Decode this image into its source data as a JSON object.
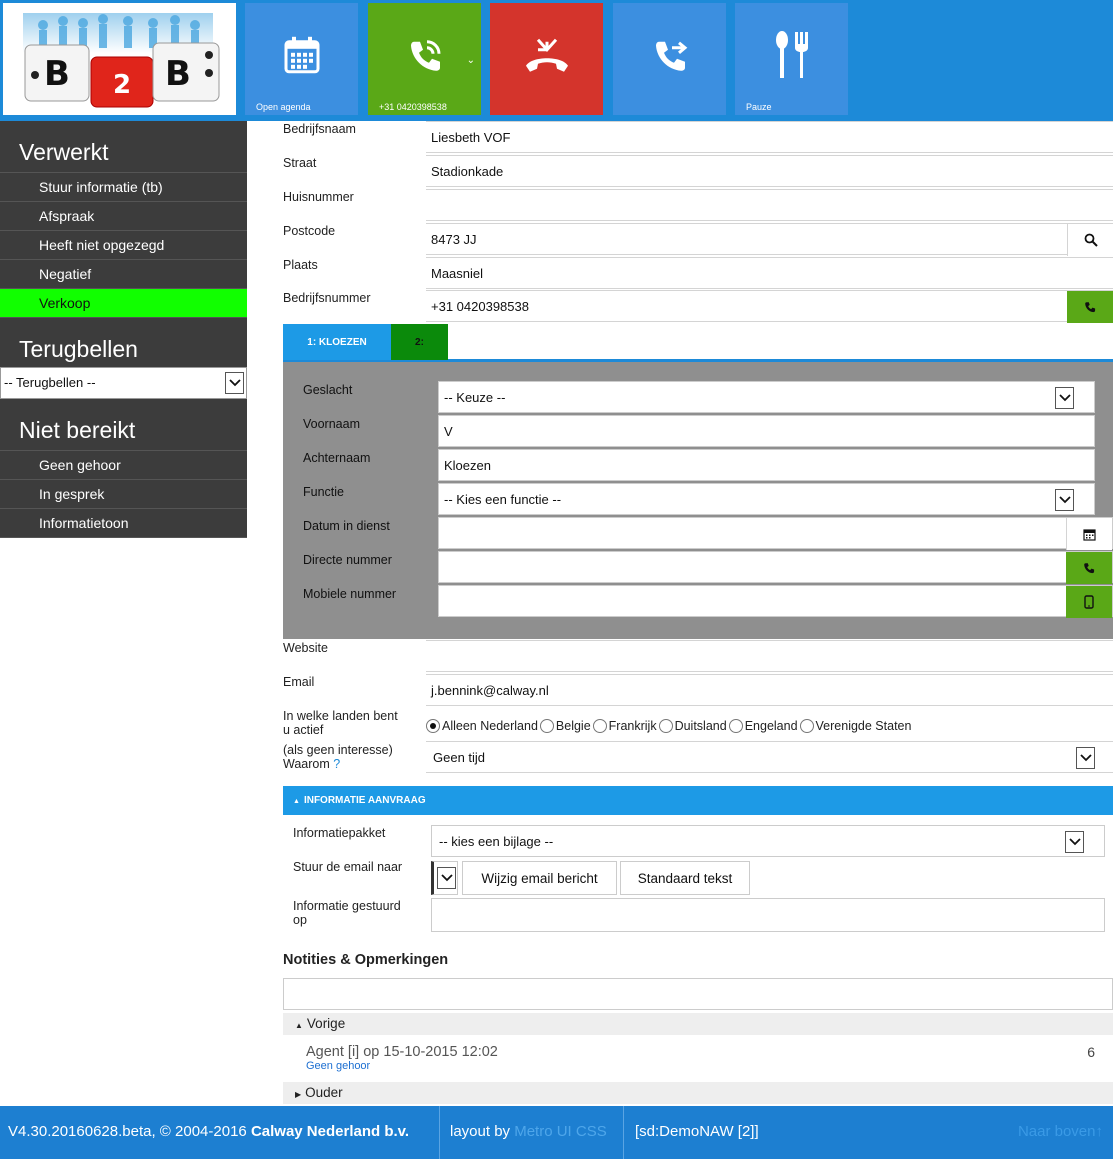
{
  "topbar": {
    "logo_text": [
      "B",
      "2",
      "B"
    ],
    "tiles": [
      {
        "label": "Open agenda",
        "icon": "calendar-icon",
        "color": "#3c8fe0"
      },
      {
        "label": "+31 0420398538",
        "icon": "phone-ringing-icon",
        "color": "#5aa817",
        "dropdown": "⌄"
      },
      {
        "label": "",
        "icon": "hang-up-icon",
        "color": "#d4342c"
      },
      {
        "label": "",
        "icon": "transfer-call-icon",
        "color": "#3c8fe0"
      },
      {
        "label": "Pauze",
        "icon": "fork-spoon-icon",
        "color": "#3c8fe0"
      }
    ]
  },
  "sidebar": {
    "verwerkt": {
      "title": "Verwerkt",
      "items": [
        "Stuur informatie (tb)",
        "Afspraak",
        "Heeft niet opgezegd",
        "Negatief",
        "Verkoop"
      ],
      "active": "Verkoop"
    },
    "terugbellen": {
      "title": "Terugbellen",
      "select_value": "-- Terugbellen --"
    },
    "niet_bereikt": {
      "title": "Niet bereikt",
      "items": [
        "Geen gehoor",
        "In gesprek",
        "Informatietoon"
      ]
    }
  },
  "company": {
    "bedrijfsnaam": {
      "label": "Bedrijfsnaam",
      "value": "Liesbeth VOF"
    },
    "straat": {
      "label": "Straat",
      "value": "Stadionkade"
    },
    "huisnummer": {
      "label": "Huisnummer",
      "value": ""
    },
    "postcode": {
      "label": "Postcode",
      "value": "8473 JJ"
    },
    "plaats": {
      "label": "Plaats",
      "value": "Maasniel"
    },
    "bedrijfsnummer": {
      "label": "Bedrijfsnummer",
      "value": "+31 0420398538"
    }
  },
  "tabs": [
    {
      "label": "1: KLOEZEN",
      "color": "#1d9ae6"
    },
    {
      "label": "2:",
      "color": "#0b8a0b"
    }
  ],
  "contact": {
    "geslacht": {
      "label": "Geslacht",
      "value": "-- Keuze --"
    },
    "voornaam": {
      "label": "Voornaam",
      "value": "V"
    },
    "achternaam": {
      "label": "Achternaam",
      "value": "Kloezen"
    },
    "functie": {
      "label": "Functie",
      "value": "-- Kies een functie --"
    },
    "datum": {
      "label": "Datum in dienst",
      "value": ""
    },
    "directe": {
      "label": "Directe nummer",
      "value": ""
    },
    "mobiel": {
      "label": "Mobiele nummer",
      "value": ""
    }
  },
  "extra": {
    "website": {
      "label": "Website",
      "value": ""
    },
    "email": {
      "label": "Email",
      "value": "j.bennink@calway.nl"
    },
    "landen": {
      "label_line1": "In welke landen bent",
      "label_line2": "u actief",
      "options": [
        "Alleen Nederland",
        "Belgie",
        "Frankrijk",
        "Duitsland",
        "Engeland",
        "Verenigde Staten"
      ],
      "selected": "Alleen Nederland"
    },
    "waarom": {
      "label_line1": "(als geen interesse)",
      "label_line2": "Waarom",
      "help": "?",
      "value": "Geen tijd"
    }
  },
  "info": {
    "section_title": "INFORMATIE AANVRAAG",
    "section_icon": "▲",
    "pakket": {
      "label": "Informatiepakket",
      "value": "-- kies een bijlage --"
    },
    "email_naar": {
      "label": "Stuur de email naar"
    },
    "wijzig_button": "Wijzig email bericht",
    "standaard_button": "Standaard tekst",
    "gestuurd": {
      "label_line1": "Informatie gestuurd",
      "label_line2": "op",
      "value": ""
    }
  },
  "notes": {
    "title": "Notities & Opmerkingen",
    "input_value": "",
    "groups": [
      {
        "label": "Vorige",
        "icon": "▲"
      },
      {
        "label": "Ouder",
        "icon": "▶"
      }
    ],
    "entry": {
      "title": "Agent [i] op 15-10-2015 12:02",
      "sub": "Geen gehoor",
      "count": "6"
    }
  },
  "footer": {
    "version_prefix": "V4.30.20160628.beta, © 2004-2016 ",
    "company": "Calway Nederland b.v.",
    "layout_prefix": "layout by ",
    "layout_link": "Metro UI CSS",
    "session": "[sd:DemoNAW [2]]",
    "back_to_top": "Naar boven",
    "back_icon": "↑"
  }
}
